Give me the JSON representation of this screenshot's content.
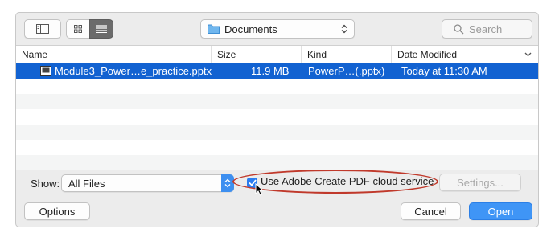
{
  "toolbar": {
    "location": "Documents",
    "search_placeholder": "Search"
  },
  "columns": [
    "Name",
    "Size",
    "Kind",
    "Date Modified"
  ],
  "files": [
    {
      "name": "Module3_Power…e_practice.pptx",
      "size": "11.9 MB",
      "kind": "PowerP…(.pptx)",
      "date": "Today at 11:30 AM"
    }
  ],
  "bottom": {
    "show_label": "Show:",
    "format_value": "All Files",
    "checkbox_label": "Use Adobe Create PDF cloud service",
    "checkbox_checked": true,
    "settings_label": "Settings..."
  },
  "buttons": {
    "options": "Options",
    "cancel": "Cancel",
    "open": "Open"
  },
  "colors": {
    "selection": "#1262d1",
    "primary_button": "#3f95f6",
    "annotation": "#c0392b"
  },
  "icons": [
    "sidebar-icon",
    "grid-view-icon",
    "list-view-icon",
    "folder-icon",
    "chevron-updown-icon",
    "search-icon",
    "sort-chevron-icon",
    "presentation-file-icon",
    "checkmark-icon",
    "cursor-icon"
  ]
}
